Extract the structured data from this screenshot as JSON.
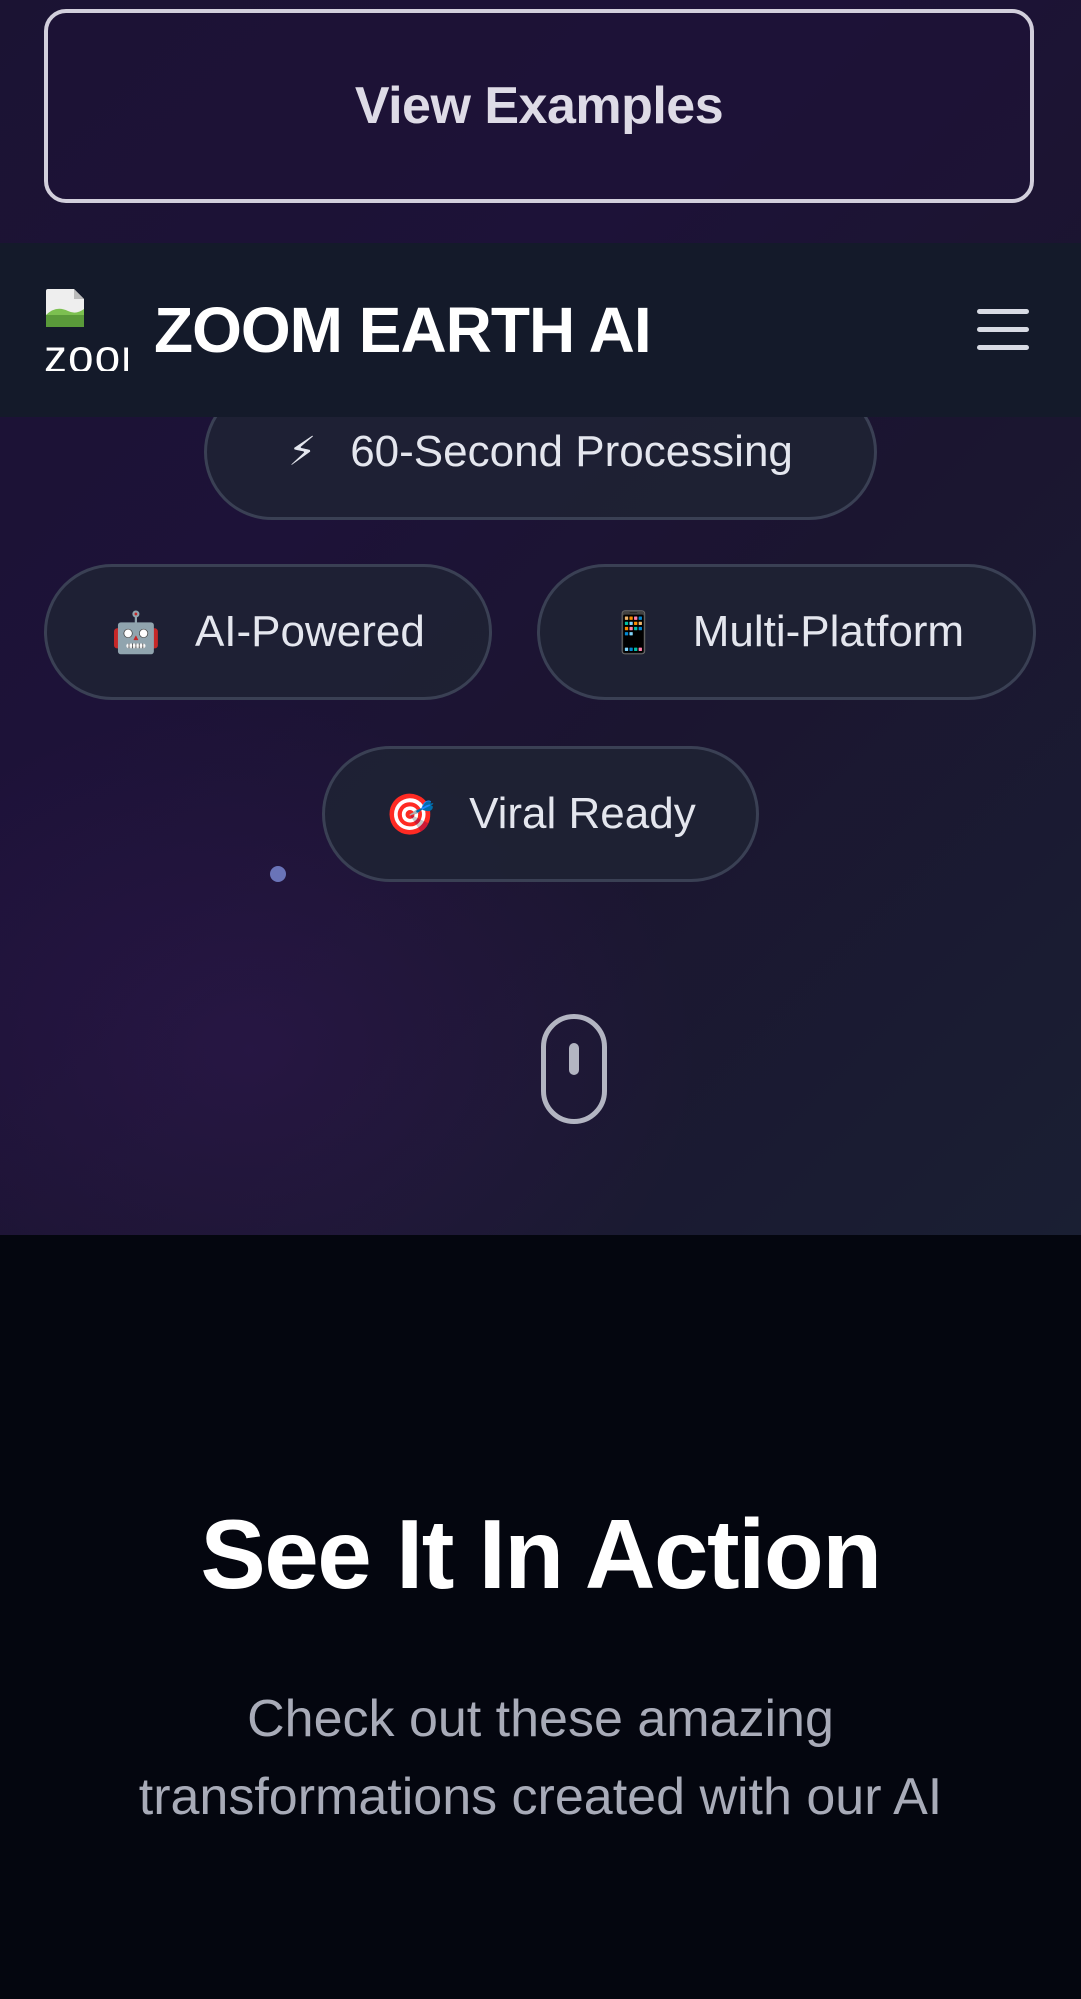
{
  "hero": {
    "view_examples_label": "View Examples",
    "features": [
      {
        "icon": "lightning-icon",
        "glyph": "⚡",
        "label": "60-Second Processing"
      },
      {
        "icon": "robot-icon",
        "glyph": "🤖",
        "label": "AI-Powered"
      },
      {
        "icon": "mobile-phone-icon",
        "glyph": "📱",
        "label": "Multi-Platform"
      },
      {
        "icon": "target-icon",
        "glyph": "🎯",
        "label": "Viral Ready"
      }
    ]
  },
  "navbar": {
    "logo_alt": "zoom",
    "brand_name": "ZOOM EARTH AI",
    "menu_icon": "hamburger-menu-icon"
  },
  "action_section": {
    "title": "See It In Action",
    "subtitle": "Check out these amazing transformations created with our AI"
  },
  "colors": {
    "hero_bg": "#1d1238",
    "navbar_bg": "#141a2a",
    "section_bg": "#04060f",
    "pill_border": "#3a4054",
    "accent_dot": "#6a74b8"
  }
}
